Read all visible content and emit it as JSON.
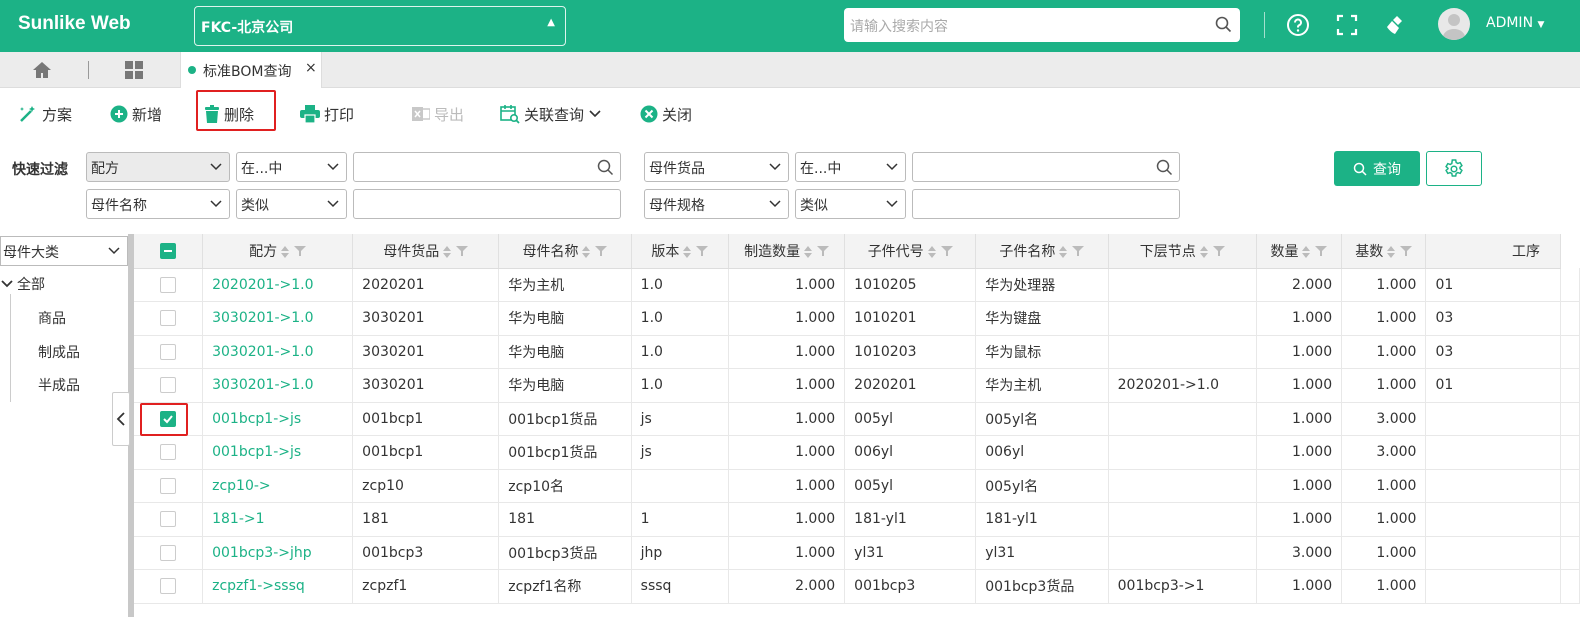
{
  "app": {
    "logo": "Sunlike Web",
    "company": "FKC-北京公司",
    "search_placeholder": "请输入搜索内容",
    "user": "ADMIN",
    "brand_color": "#1cb286"
  },
  "tabs": {
    "active_label": "标准BOM查询",
    "close": "×"
  },
  "toolbar": {
    "plan": "方案",
    "add": "新增",
    "delete": "删除",
    "print": "打印",
    "export": "导出",
    "related": "关联查询",
    "close": "关闭"
  },
  "filter": {
    "label": "快速过滤",
    "row1": [
      {
        "field": "配方",
        "op": "在...中",
        "value": ""
      },
      {
        "field": "母件货品",
        "op": "在...中",
        "value": ""
      }
    ],
    "row2": [
      {
        "field": "母件名称",
        "op": "类似",
        "value": ""
      },
      {
        "field": "母件规格",
        "op": "类似",
        "value": ""
      }
    ],
    "query": "查询"
  },
  "left": {
    "category_select": "母件大类",
    "root": "全部",
    "items": [
      "商品",
      "制成品",
      "半成品"
    ]
  },
  "grid": {
    "columns": [
      "配方",
      "母件货品",
      "母件名称",
      "版本",
      "制造数量",
      "子件代号",
      "子件名称",
      "下层节点",
      "数量",
      "基数",
      "工序"
    ],
    "rows": [
      {
        "checked": false,
        "c": [
          "2020201->1.0",
          "2020201",
          "华为主机",
          "1.0",
          "1.000",
          "1010205",
          "华为处理器",
          "",
          "2.000",
          "1.000",
          "01"
        ]
      },
      {
        "checked": false,
        "c": [
          "3030201->1.0",
          "3030201",
          "华为电脑",
          "1.0",
          "1.000",
          "1010201",
          "华为键盘",
          "",
          "1.000",
          "1.000",
          "03"
        ]
      },
      {
        "checked": false,
        "c": [
          "3030201->1.0",
          "3030201",
          "华为电脑",
          "1.0",
          "1.000",
          "1010203",
          "华为鼠标",
          "",
          "1.000",
          "1.000",
          "03"
        ]
      },
      {
        "checked": false,
        "c": [
          "3030201->1.0",
          "3030201",
          "华为电脑",
          "1.0",
          "1.000",
          "2020201",
          "华为主机",
          "2020201->1.0",
          "1.000",
          "1.000",
          "01"
        ]
      },
      {
        "checked": true,
        "c": [
          "001bcp1->js",
          "001bcp1",
          "001bcp1货品",
          "js",
          "1.000",
          "005yl",
          "005yl名",
          "",
          "1.000",
          "3.000",
          ""
        ]
      },
      {
        "checked": false,
        "c": [
          "001bcp1->js",
          "001bcp1",
          "001bcp1货品",
          "js",
          "1.000",
          "006yl",
          "006yl",
          "",
          "1.000",
          "3.000",
          ""
        ]
      },
      {
        "checked": false,
        "c": [
          "zcp10->",
          "zcp10",
          "zcp10名",
          "",
          "1.000",
          "005yl",
          "005yl名",
          "",
          "1.000",
          "1.000",
          ""
        ]
      },
      {
        "checked": false,
        "c": [
          "181->1",
          "181",
          "181",
          "1",
          "1.000",
          "181-yl1",
          "181-yl1",
          "",
          "1.000",
          "1.000",
          ""
        ]
      },
      {
        "checked": false,
        "c": [
          "001bcp3->jhp",
          "001bcp3",
          "001bcp3货品",
          "jhp",
          "1.000",
          "yl31",
          "yl31",
          "",
          "3.000",
          "1.000",
          ""
        ]
      },
      {
        "checked": false,
        "c": [
          "zcpzf1->sssq",
          "zcpzf1",
          "zcpzf1名称",
          "sssq",
          "2.000",
          "001bcp3",
          "001bcp3货品",
          "001bcp3->1",
          "1.000",
          "1.000",
          ""
        ]
      }
    ]
  }
}
